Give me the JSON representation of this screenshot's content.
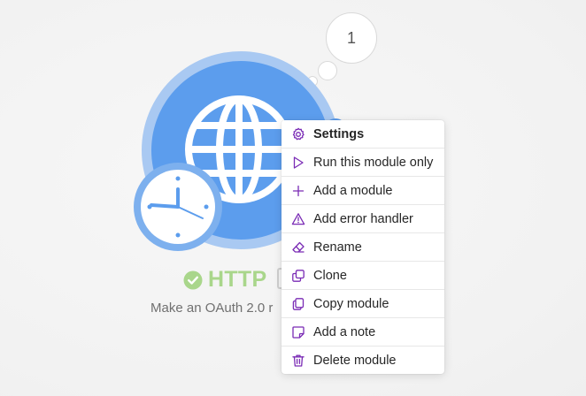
{
  "operation_bubble": {
    "count": "1"
  },
  "module": {
    "name": "HTTP",
    "subtitle": "Make an OAuth 2.0 r",
    "status_icon": "check-circle-icon",
    "app_icon": "globe-icon",
    "schedule_icon": "clock-icon"
  },
  "context_menu": {
    "items": [
      {
        "label": "Settings",
        "icon": "gear-icon"
      },
      {
        "label": "Run this module only",
        "icon": "play-icon"
      },
      {
        "label": "Add a module",
        "icon": "plus-icon"
      },
      {
        "label": "Add error handler",
        "icon": "warning-icon"
      },
      {
        "label": "Rename",
        "icon": "eraser-icon"
      },
      {
        "label": "Clone",
        "icon": "clone-icon"
      },
      {
        "label": "Copy module",
        "icon": "copy-icon"
      },
      {
        "label": "Add a note",
        "icon": "note-icon"
      },
      {
        "label": "Delete module",
        "icon": "trash-icon"
      }
    ]
  },
  "colors": {
    "module_blue": "#5c9ded",
    "module_ring": "#a9c9f2",
    "status_green": "#a9d68b",
    "menu_icon_purple": "#7a2bb5"
  }
}
